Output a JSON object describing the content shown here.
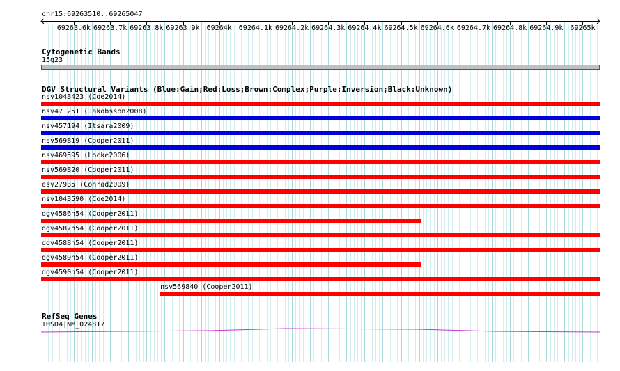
{
  "location": "chr15:69263510..69265047",
  "ruler": {
    "start": 69263510,
    "end": 69265047,
    "ticks": [
      {
        "pos": 69263600,
        "label": "69263.6k"
      },
      {
        "pos": 69263700,
        "label": "69263.7k"
      },
      {
        "pos": 69263800,
        "label": "69263.8k"
      },
      {
        "pos": 69263900,
        "label": "69263.9k"
      },
      {
        "pos": 69264000,
        "label": "69264k"
      },
      {
        "pos": 69264100,
        "label": "69264.1k"
      },
      {
        "pos": 69264200,
        "label": "69264.2k"
      },
      {
        "pos": 69264300,
        "label": "69264.3k"
      },
      {
        "pos": 69264400,
        "label": "69264.4k"
      },
      {
        "pos": 69264500,
        "label": "69264.5k"
      },
      {
        "pos": 69264600,
        "label": "69264.6k"
      },
      {
        "pos": 69264700,
        "label": "69264.7k"
      },
      {
        "pos": 69264800,
        "label": "69264.8k"
      },
      {
        "pos": 69264900,
        "label": "69264.9k"
      },
      {
        "pos": 69265000,
        "label": "69265k"
      }
    ]
  },
  "cytoband_track": {
    "title": "Cytogenetic Bands",
    "band": "15q23"
  },
  "dgv_track": {
    "title": "DGV Structural Variants (Blue:Gain;Red:Loss;Brown:Complex;Purple:Inversion;Black:Unknown)",
    "colors": {
      "loss": "#ff0000",
      "gain": "#0000dd"
    },
    "features": [
      {
        "label": "nsv1043423 (Coe2014)",
        "type": "loss",
        "start": 69263510,
        "end": 69265047
      },
      {
        "label": "nsv471251 (Jakobsson2008)",
        "type": "gain",
        "start": 69263510,
        "end": 69265047
      },
      {
        "label": "nsv457194 (Itsara2009)",
        "type": "gain",
        "start": 69263510,
        "end": 69265047
      },
      {
        "label": "nsv569819 (Cooper2011)",
        "type": "gain",
        "start": 69263510,
        "end": 69265047
      },
      {
        "label": "nsv469595 (Locke2006)",
        "type": "loss",
        "start": 69263510,
        "end": 69265047
      },
      {
        "label": "nsv569820 (Cooper2011)",
        "type": "loss",
        "start": 69263510,
        "end": 69265047
      },
      {
        "label": "esv27935 (Conrad2009)",
        "type": "loss",
        "start": 69263510,
        "end": 69265047
      },
      {
        "label": "nsv1043590 (Coe2014)",
        "type": "loss",
        "start": 69263510,
        "end": 69265047
      },
      {
        "label": "dgv4586n54 (Cooper2011)",
        "type": "loss",
        "start": 69263510,
        "end": 69264555
      },
      {
        "label": "dgv4587n54 (Cooper2011)",
        "type": "loss",
        "start": 69263510,
        "end": 69265047
      },
      {
        "label": "dgv4588n54 (Cooper2011)",
        "type": "loss",
        "start": 69263510,
        "end": 69265047
      },
      {
        "label": "dgv4589n54 (Cooper2011)",
        "type": "loss",
        "start": 69263510,
        "end": 69264555
      },
      {
        "label": "dgv4590n54 (Cooper2011)",
        "type": "loss",
        "start": 69263510,
        "end": 69265047
      },
      {
        "label": "nsv569840 (Cooper2011)",
        "type": "loss",
        "start": 69263836,
        "end": 69265047
      }
    ]
  },
  "refseq_track": {
    "title": "RefSeq Genes",
    "gene_label": "THSD4|NM_024817",
    "color": "#cc33cc"
  }
}
